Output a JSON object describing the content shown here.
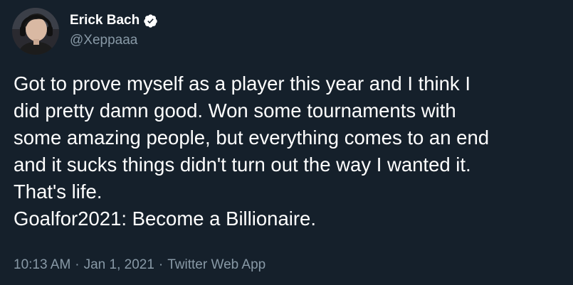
{
  "author": {
    "display_name": "Erick Bach",
    "handle": "@Xeppaaa",
    "verified": true,
    "avatar_icon": "user-avatar"
  },
  "tweet": {
    "lines": [
      "Got to prove myself as a player this year and I think I",
      "did pretty damn good. Won some tournaments with",
      "some amazing people, but everything comes to an end",
      "and it sucks things didn't turn out the way I wanted it.",
      "That's life.",
      "Goalfor2021: Become a Billionaire."
    ]
  },
  "meta": {
    "time": "10:13 AM",
    "separator": "·",
    "date": "Jan 1, 2021",
    "source": "Twitter Web App"
  },
  "colors": {
    "background": "#15202b",
    "text": "#ffffff",
    "secondary": "#8899a6"
  }
}
